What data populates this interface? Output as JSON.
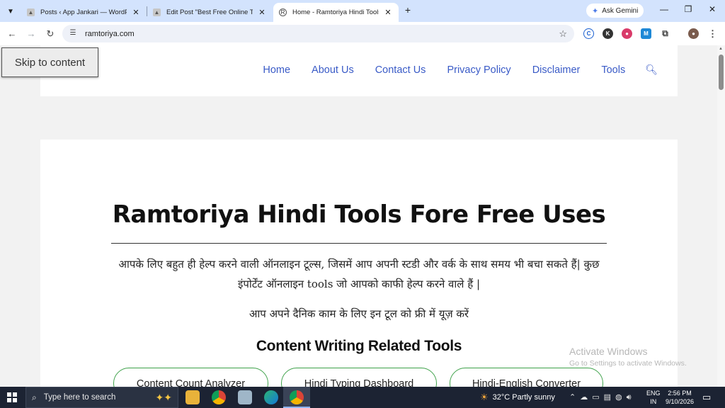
{
  "browser": {
    "tabs": [
      {
        "label": "Posts ‹ App Jankari — WordPre",
        "favicon": "wordpress-icon"
      },
      {
        "label": "Edit Post \"Best Free Online Tool",
        "favicon": "wordpress-icon"
      },
      {
        "label": "Home - Ramtoriya Hindi Tools",
        "favicon": "site-logo-icon",
        "active": true
      }
    ],
    "gemini_label": "Ask Gemini",
    "url": "ramtoriya.com"
  },
  "page": {
    "skip_link": "Skip to content",
    "nav": [
      "Home",
      "About Us",
      "Contact Us",
      "Privacy Policy",
      "Disclaimer",
      "Tools"
    ],
    "title": "Ramtoriya Hindi Tools Fore Free Uses",
    "intro_line1": "आपके लिए बहुत ही हेल्प करने वाली ऑनलाइन टूल्स, जिसमें आप अपनी स्टडी और वर्क के साथ समय भी बचा सकते हैं| कुछ",
    "intro_line2": "इंपोर्टेंट ऑनलाइन tools जो आपको काफी हेल्प करने वाले हैं |",
    "subtext": "आप अपने दैनिक काम के लिए इन टूल को फ्री में यूज़ करें",
    "section_title": "Content Writing Related Tools",
    "tool_buttons": [
      "Content Count Analyzer",
      "Hindi Typing Dashboard",
      "Hindi-English Converter"
    ]
  },
  "watermark": {
    "line1": "Activate Windows",
    "line2": "Go to Settings to activate Windows."
  },
  "taskbar": {
    "search_placeholder": "Type here to search",
    "weather": "32°C  Partly sunny",
    "lang_line1": "ENG",
    "lang_line2": "IN",
    "time": "2:56 PM",
    "date": "9/10/2026"
  },
  "colors": {
    "link": "#3a5bc7",
    "button_border": "#3ea14a",
    "tab_strip": "#d3e3fd",
    "taskbar": "#1c2333"
  }
}
